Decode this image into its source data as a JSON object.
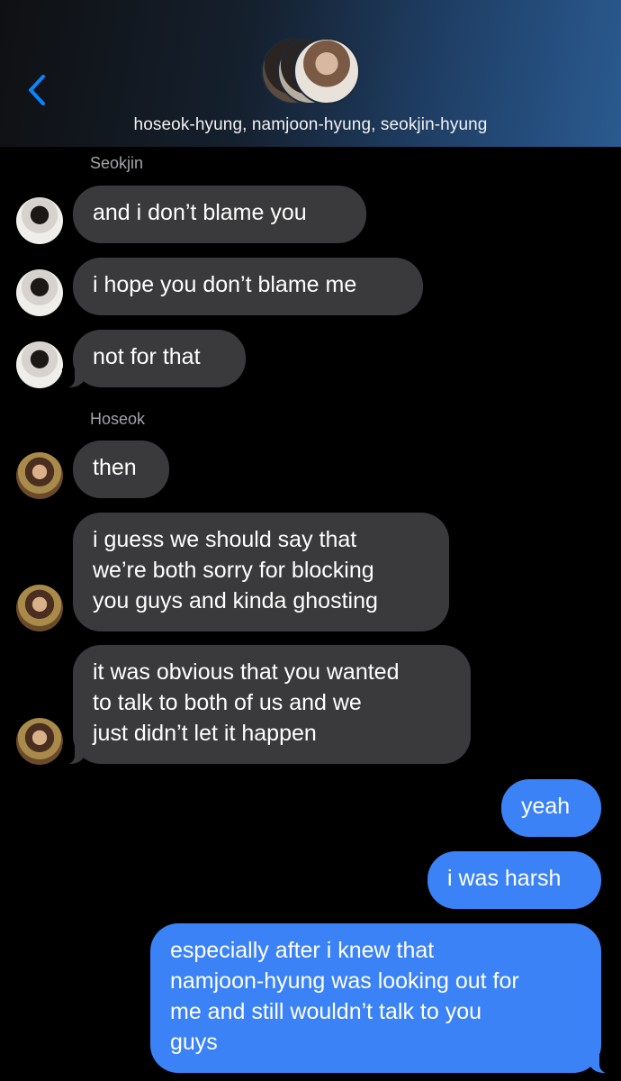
{
  "header": {
    "chat_title": "hoseok-hyung, namjoon-hyung, seokjin-hyung",
    "accent_color": "#0a84ff",
    "group_avatar_icon": "group-avatar-stack"
  },
  "messages": {
    "sender_seokjin": "Seokjin",
    "sender_hoseok": "Hoseok",
    "m1": "and i don’t blame you",
    "m2": "i hope you don’t blame me",
    "m3": "not for that",
    "m4": "then",
    "m5_l1": "i guess we should say that",
    "m5_l2": "we’re both sorry for blocking",
    "m5_l3": "you guys and kinda ghosting",
    "m6_l1": "it was obvious that you wanted",
    "m6_l2": "to talk to both of us and we",
    "m6_l3": "just didn’t let it happen",
    "o1": "yeah",
    "o2": "i was harsh",
    "o3_l1": "especially after i knew that",
    "o3_l2": "namjoon-hyung was looking out for",
    "o3_l3": "me and still wouldn’t talk to you",
    "o3_l4": "guys"
  },
  "colors": {
    "incoming_bubble": "#3a3a3c",
    "outgoing_bubble": "#3b82f6",
    "background": "#000000"
  }
}
